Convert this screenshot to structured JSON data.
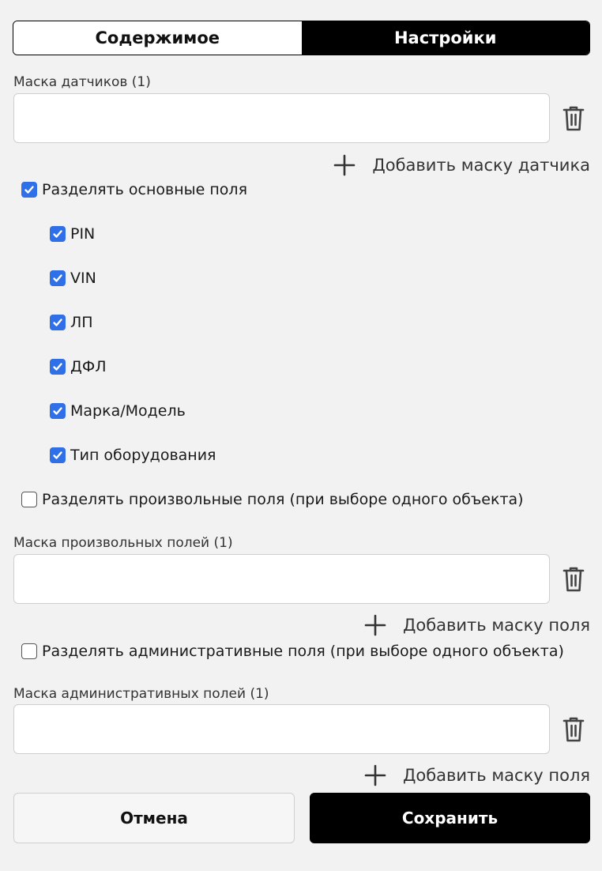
{
  "tabs": [
    {
      "label": "Содержимое",
      "active": false
    },
    {
      "label": "Настройки",
      "active": true
    }
  ],
  "sensor_mask": {
    "label": "Маска датчиков (1)",
    "value": "",
    "placeholder": "",
    "add_label": "Добавить маску датчика"
  },
  "split_main_fields": {
    "label": "Разделять основные поля",
    "checked": true,
    "items": [
      {
        "label": "PIN",
        "checked": true
      },
      {
        "label": "VIN",
        "checked": true
      },
      {
        "label": "ЛП",
        "checked": true
      },
      {
        "label": "ДФЛ",
        "checked": true
      },
      {
        "label": "Марка/Модель",
        "checked": true
      },
      {
        "label": "Тип оборудования",
        "checked": true
      }
    ]
  },
  "split_custom_fields": {
    "label": "Разделять произвольные поля (при выборе одного объекта)",
    "checked": false
  },
  "custom_fields_mask": {
    "label": "Маска произвольных полей (1)",
    "value": "",
    "placeholder": "",
    "add_label": "Добавить маску поля"
  },
  "split_admin_fields": {
    "label": "Разделять административные поля (при выборе одного объекта)",
    "checked": false
  },
  "admin_fields_mask": {
    "label": "Маска административных полей (1)",
    "value": "",
    "placeholder": "",
    "add_label": "Добавить маску поля"
  },
  "footer": {
    "cancel_label": "Отмена",
    "save_label": "Сохранить"
  },
  "colors": {
    "checkbox_checked": "#2f6fe8",
    "primary_button": "#000000",
    "background": "#f2f2f2"
  }
}
